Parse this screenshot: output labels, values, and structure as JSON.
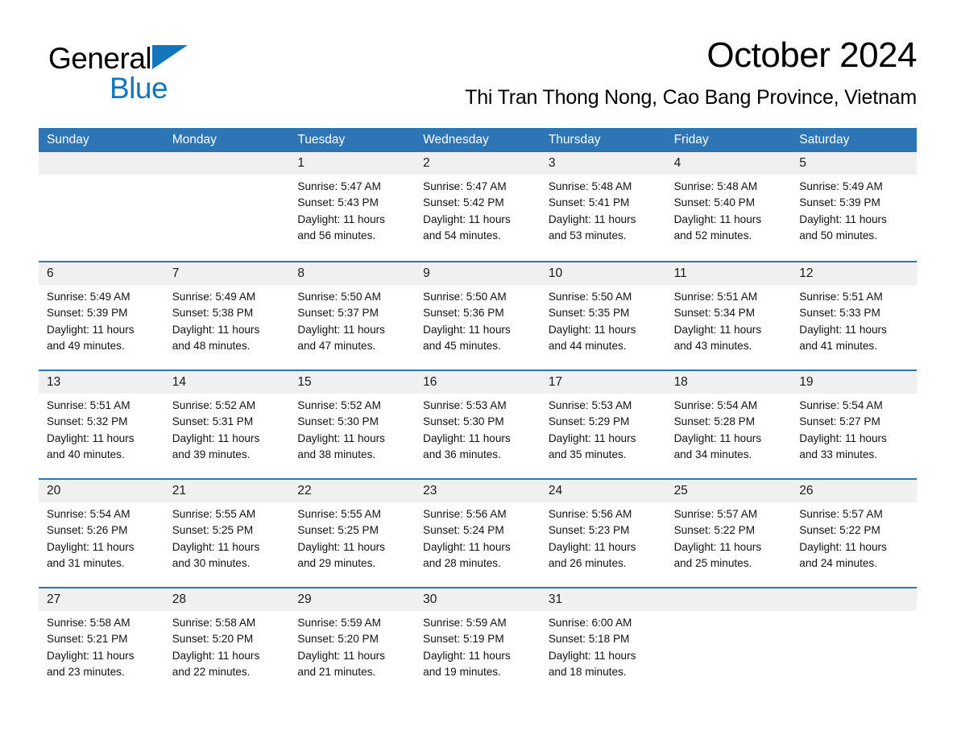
{
  "brand": {
    "name_part1": "General",
    "name_part2": "Blue",
    "triangle_color": "#1375bc"
  },
  "header": {
    "title": "October 2024",
    "location": "Thi Tran Thong Nong, Cao Bang Province, Vietnam"
  },
  "theme": {
    "header_blue": "#2e75b6",
    "band_gray": "#f0f0f0",
    "text_black": "#121212",
    "logo_blue": "#1375bc"
  },
  "calendar": {
    "weekdays": [
      "Sunday",
      "Monday",
      "Tuesday",
      "Wednesday",
      "Thursday",
      "Friday",
      "Saturday"
    ],
    "weeks": [
      [
        {
          "day": "",
          "info": ""
        },
        {
          "day": "",
          "info": ""
        },
        {
          "day": "1",
          "info": "Sunrise: 5:47 AM\nSunset: 5:43 PM\nDaylight: 11 hours\nand 56 minutes."
        },
        {
          "day": "2",
          "info": "Sunrise: 5:47 AM\nSunset: 5:42 PM\nDaylight: 11 hours\nand 54 minutes."
        },
        {
          "day": "3",
          "info": "Sunrise: 5:48 AM\nSunset: 5:41 PM\nDaylight: 11 hours\nand 53 minutes."
        },
        {
          "day": "4",
          "info": "Sunrise: 5:48 AM\nSunset: 5:40 PM\nDaylight: 11 hours\nand 52 minutes."
        },
        {
          "day": "5",
          "info": "Sunrise: 5:49 AM\nSunset: 5:39 PM\nDaylight: 11 hours\nand 50 minutes."
        }
      ],
      [
        {
          "day": "6",
          "info": "Sunrise: 5:49 AM\nSunset: 5:39 PM\nDaylight: 11 hours\nand 49 minutes."
        },
        {
          "day": "7",
          "info": "Sunrise: 5:49 AM\nSunset: 5:38 PM\nDaylight: 11 hours\nand 48 minutes."
        },
        {
          "day": "8",
          "info": "Sunrise: 5:50 AM\nSunset: 5:37 PM\nDaylight: 11 hours\nand 47 minutes."
        },
        {
          "day": "9",
          "info": "Sunrise: 5:50 AM\nSunset: 5:36 PM\nDaylight: 11 hours\nand 45 minutes."
        },
        {
          "day": "10",
          "info": "Sunrise: 5:50 AM\nSunset: 5:35 PM\nDaylight: 11 hours\nand 44 minutes."
        },
        {
          "day": "11",
          "info": "Sunrise: 5:51 AM\nSunset: 5:34 PM\nDaylight: 11 hours\nand 43 minutes."
        },
        {
          "day": "12",
          "info": "Sunrise: 5:51 AM\nSunset: 5:33 PM\nDaylight: 11 hours\nand 41 minutes."
        }
      ],
      [
        {
          "day": "13",
          "info": "Sunrise: 5:51 AM\nSunset: 5:32 PM\nDaylight: 11 hours\nand 40 minutes."
        },
        {
          "day": "14",
          "info": "Sunrise: 5:52 AM\nSunset: 5:31 PM\nDaylight: 11 hours\nand 39 minutes."
        },
        {
          "day": "15",
          "info": "Sunrise: 5:52 AM\nSunset: 5:30 PM\nDaylight: 11 hours\nand 38 minutes."
        },
        {
          "day": "16",
          "info": "Sunrise: 5:53 AM\nSunset: 5:30 PM\nDaylight: 11 hours\nand 36 minutes."
        },
        {
          "day": "17",
          "info": "Sunrise: 5:53 AM\nSunset: 5:29 PM\nDaylight: 11 hours\nand 35 minutes."
        },
        {
          "day": "18",
          "info": "Sunrise: 5:54 AM\nSunset: 5:28 PM\nDaylight: 11 hours\nand 34 minutes."
        },
        {
          "day": "19",
          "info": "Sunrise: 5:54 AM\nSunset: 5:27 PM\nDaylight: 11 hours\nand 33 minutes."
        }
      ],
      [
        {
          "day": "20",
          "info": "Sunrise: 5:54 AM\nSunset: 5:26 PM\nDaylight: 11 hours\nand 31 minutes."
        },
        {
          "day": "21",
          "info": "Sunrise: 5:55 AM\nSunset: 5:25 PM\nDaylight: 11 hours\nand 30 minutes."
        },
        {
          "day": "22",
          "info": "Sunrise: 5:55 AM\nSunset: 5:25 PM\nDaylight: 11 hours\nand 29 minutes."
        },
        {
          "day": "23",
          "info": "Sunrise: 5:56 AM\nSunset: 5:24 PM\nDaylight: 11 hours\nand 28 minutes."
        },
        {
          "day": "24",
          "info": "Sunrise: 5:56 AM\nSunset: 5:23 PM\nDaylight: 11 hours\nand 26 minutes."
        },
        {
          "day": "25",
          "info": "Sunrise: 5:57 AM\nSunset: 5:22 PM\nDaylight: 11 hours\nand 25 minutes."
        },
        {
          "day": "26",
          "info": "Sunrise: 5:57 AM\nSunset: 5:22 PM\nDaylight: 11 hours\nand 24 minutes."
        }
      ],
      [
        {
          "day": "27",
          "info": "Sunrise: 5:58 AM\nSunset: 5:21 PM\nDaylight: 11 hours\nand 23 minutes."
        },
        {
          "day": "28",
          "info": "Sunrise: 5:58 AM\nSunset: 5:20 PM\nDaylight: 11 hours\nand 22 minutes."
        },
        {
          "day": "29",
          "info": "Sunrise: 5:59 AM\nSunset: 5:20 PM\nDaylight: 11 hours\nand 21 minutes."
        },
        {
          "day": "30",
          "info": "Sunrise: 5:59 AM\nSunset: 5:19 PM\nDaylight: 11 hours\nand 19 minutes."
        },
        {
          "day": "31",
          "info": "Sunrise: 6:00 AM\nSunset: 5:18 PM\nDaylight: 11 hours\nand 18 minutes."
        },
        {
          "day": "",
          "info": ""
        },
        {
          "day": "",
          "info": ""
        }
      ]
    ]
  }
}
